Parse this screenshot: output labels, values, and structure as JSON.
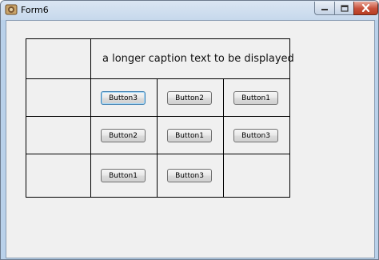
{
  "window": {
    "title": "Form6"
  },
  "title_buttons": {
    "minimize_icon": "minimize-icon",
    "maximize_icon": "maximize-icon",
    "close_icon": "close-icon"
  },
  "grid": {
    "caption": "a longer caption text to be displayed",
    "rows": [
      [
        "Button3",
        "Button2",
        "Button1"
      ],
      [
        "Button2",
        "Button1",
        "Button3"
      ],
      [
        "Button1",
        "Button3"
      ]
    ],
    "focused_button": "Button3"
  },
  "colors": {
    "close_button": "#c7503a",
    "focus_border": "#3c7fb1"
  }
}
